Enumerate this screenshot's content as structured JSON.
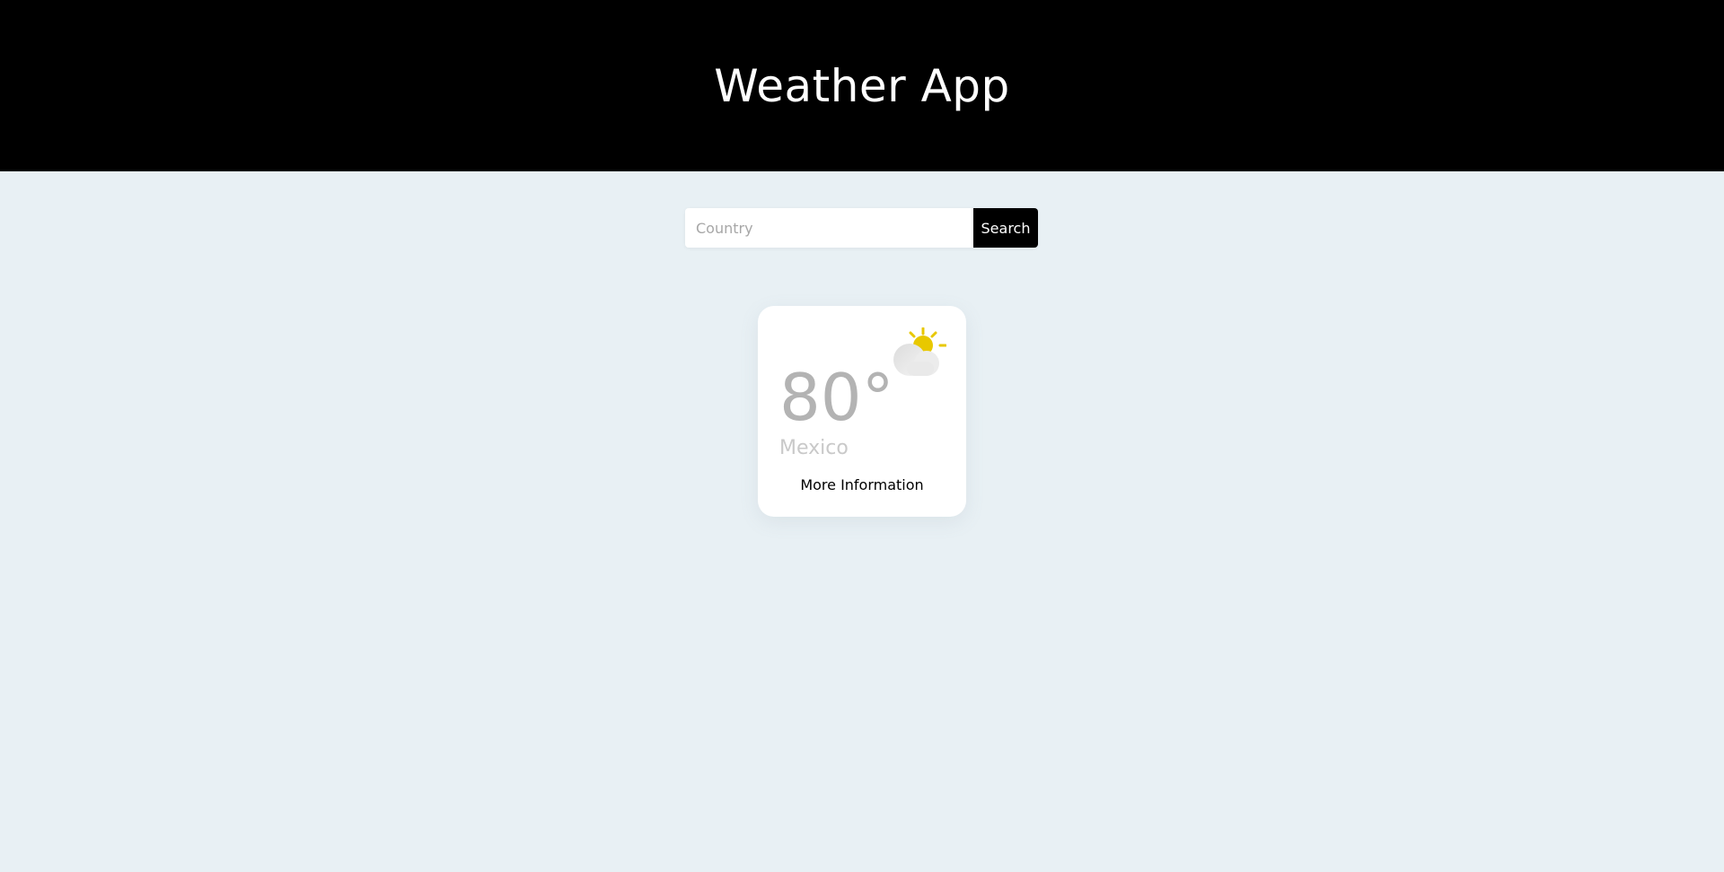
{
  "header": {
    "title": "Weather App"
  },
  "search": {
    "placeholder": "Country",
    "value": "",
    "button_label": "Search"
  },
  "weather_card": {
    "temperature": "80°",
    "location": "Mexico",
    "more_info_label": "More Information",
    "icon": "partly-cloudy-icon"
  },
  "colors": {
    "header_bg": "#000000",
    "page_bg": "#e8f0f4",
    "sun": "#e8c800",
    "button_bg": "#000000"
  }
}
